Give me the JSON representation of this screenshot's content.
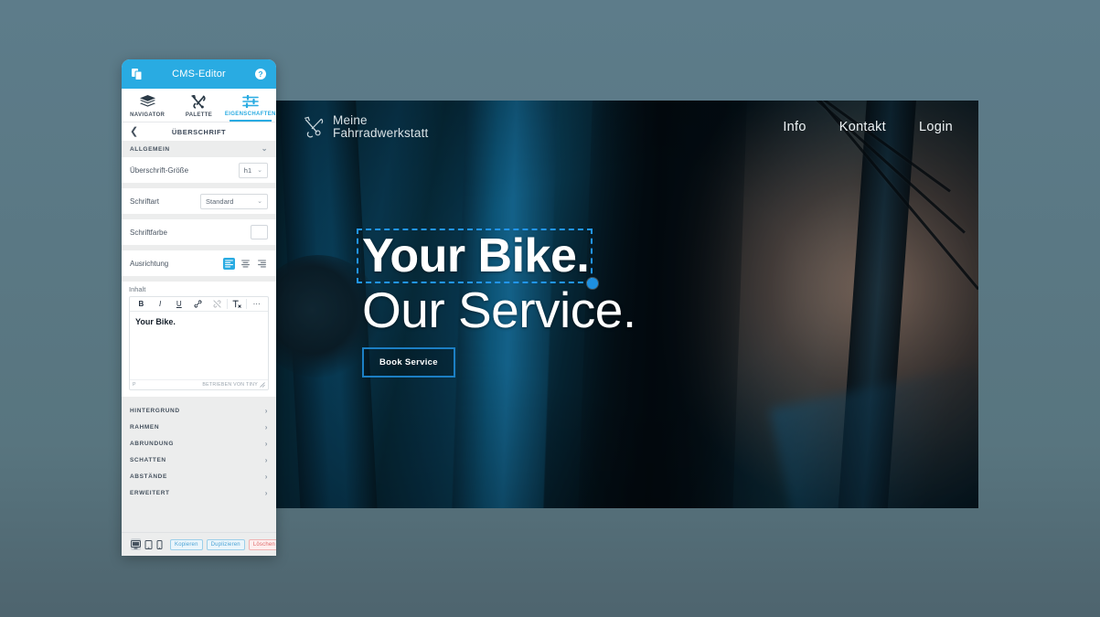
{
  "editor": {
    "app_title": "CMS-Editor",
    "header_icons": {
      "left": "copy-pages-icon",
      "right": "help-circle-icon"
    },
    "tabs": [
      {
        "label": "NAVIGATOR",
        "icon": "layers-icon",
        "active": false
      },
      {
        "label": "PALETTE",
        "icon": "tools-icon",
        "active": false
      },
      {
        "label": "EIGENSCHAFTEN",
        "icon": "sliders-icon",
        "active": true
      }
    ],
    "breadcrumb": {
      "back_icon": "chevron-left-icon",
      "title": "ÜBERSCHRIFT"
    },
    "sections": {
      "general": {
        "label": "ALLGEMEIN",
        "expanded": true,
        "chevron": "chevron-down-icon",
        "fields": {
          "heading_size": {
            "label": "Überschrift-Größe",
            "value": "h1"
          },
          "font": {
            "label": "Schriftart",
            "value": "Standard"
          },
          "font_color": {
            "label": "Schriftfarbe",
            "value": "#ffffff"
          },
          "alignment": {
            "label": "Ausrichtung",
            "value": "left",
            "options": [
              "align-left-icon",
              "align-center-icon",
              "align-right-icon"
            ]
          }
        },
        "content": {
          "label": "Inhalt",
          "toolbar": [
            {
              "name": "bold-icon",
              "glyph": "B"
            },
            {
              "name": "italic-icon",
              "glyph": "I"
            },
            {
              "name": "underline-icon",
              "glyph": "U"
            },
            {
              "name": "link-icon",
              "glyph": "link"
            },
            {
              "name": "unlink-icon",
              "glyph": "unlink"
            },
            {
              "name": "clear-formatting-icon",
              "glyph": "Tx"
            },
            {
              "name": "more-options-icon",
              "glyph": "···"
            }
          ],
          "text": "Your Bike.",
          "status_path": "P",
          "branding": "BETRIEBEN VON TINY"
        }
      },
      "collapsed": [
        {
          "label": "HINTERGRUND",
          "chevron": "chevron-right-icon"
        },
        {
          "label": "RAHMEN",
          "chevron": "chevron-right-icon"
        },
        {
          "label": "ABRUNDUNG",
          "chevron": "chevron-right-icon"
        },
        {
          "label": "SCHATTEN",
          "chevron": "chevron-right-icon"
        },
        {
          "label": "ABSTÄNDE",
          "chevron": "chevron-right-icon"
        },
        {
          "label": "ERWEITERT",
          "chevron": "chevron-right-icon"
        }
      ]
    },
    "footer": {
      "devices": [
        {
          "name": "desktop-view-icon",
          "active": true
        },
        {
          "name": "tablet-view-icon",
          "active": false
        },
        {
          "name": "mobile-view-icon",
          "active": false
        }
      ],
      "copy_label": "Kopieren",
      "duplicate_label": "Duplizieren",
      "delete_label": "Löschen"
    },
    "colors": {
      "header": "#29abe2",
      "accent": "#29abe2",
      "panel_bg": "#eceded",
      "danger": "#e06a6a"
    }
  },
  "site": {
    "brand": {
      "line1": "Meine",
      "line2": "Fahrradwerkstatt",
      "logo": "crossed-tools-icon"
    },
    "nav": [
      {
        "label": "Info"
      },
      {
        "label": "Kontakt"
      },
      {
        "label": "Login"
      }
    ],
    "hero": {
      "headline": "Your Bike.",
      "subline": "Our Service.",
      "cta_label": "Book Service",
      "selection": {
        "color": "#2196f3",
        "handle": "resize-handle"
      }
    }
  },
  "page": {
    "background": "#5d7c8a"
  }
}
